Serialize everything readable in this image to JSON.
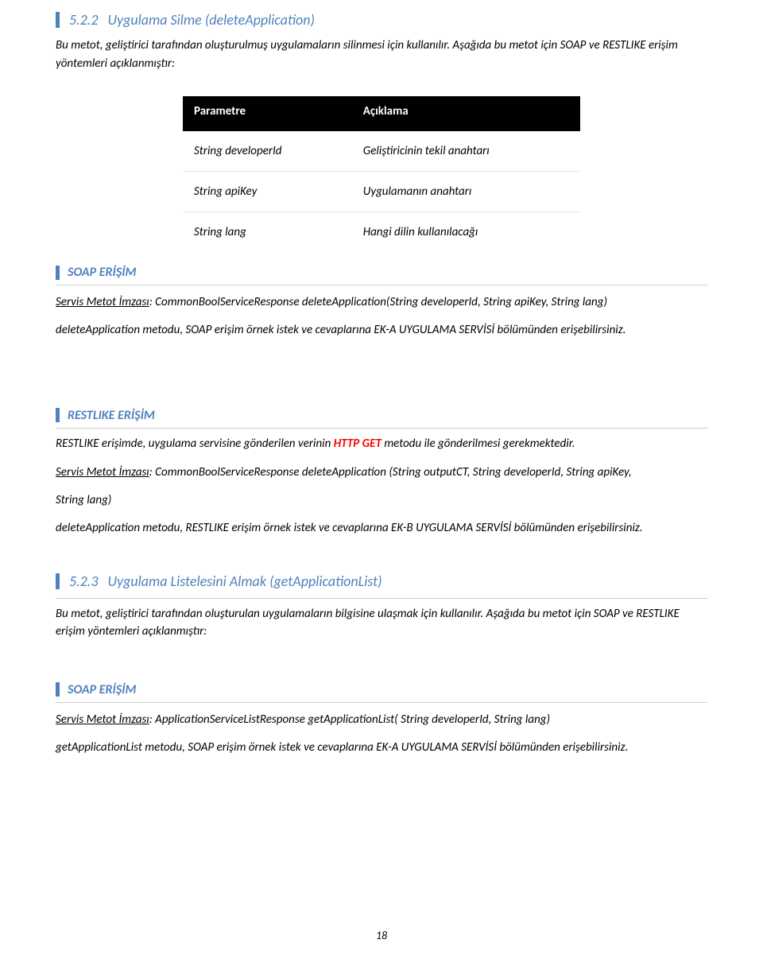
{
  "section1": {
    "num": "5.2.2",
    "title": "Uygulama Silme (deleteApplication)",
    "intro": "Bu metot, geliştirici tarafından oluşturulmuş uygulamaların silinmesi için kullanılır. Aşağıda bu metot için SOAP ve RESTLIKE erişim yöntemleri açıklanmıştır:"
  },
  "paramsTable": {
    "headers": {
      "param": "Parametre",
      "desc": "Açıklama"
    },
    "rows": [
      {
        "param": "String developerId",
        "desc": "Geliştiricinin tekil anahtarı"
      },
      {
        "param": "String apiKey",
        "desc": "Uygulamanın anahtarı"
      },
      {
        "param": "String lang",
        "desc": "Hangi dilin kullanılacağı"
      }
    ]
  },
  "soap1": {
    "label": "SOAP ERİŞİM",
    "sigPrefix": "Servis Metot İmzası",
    "sigBody": ": CommonBoolServiceResponse deleteApplication(String developerId, String apiKey, String lang)",
    "note": "deleteApplication metodu, SOAP erişim örnek istek ve cevaplarına EK-A UYGULAMA SERVİSİ bölümünden erişebilirsiniz."
  },
  "rest1": {
    "label": "RESTLIKE ERİŞİM",
    "introPre": "RESTLIKE erişimde, uygulama servisine gönderilen verinin ",
    "httpGet": "HTTP GET",
    "introPost": " metodu ile gönderilmesi gerekmektedir.",
    "sigPrefix": "Servis Metot İmzası",
    "sigBody1": ": CommonBoolServiceResponse deleteApplication (String outputCT, String developerId, String apiKey,",
    "sigBody2": "String lang)",
    "note": "deleteApplication metodu, RESTLIKE erişim örnek istek ve cevaplarına EK-B UYGULAMA SERVİSİ bölümünden erişebilirsiniz."
  },
  "section2": {
    "num": "5.2.3",
    "title": "Uygulama Listelesini Almak (getApplicationList)",
    "intro": "Bu metot, geliştirici tarafından oluşturulan uygulamaların bilgisine ulaşmak için kullanılır. Aşağıda bu metot için SOAP ve RESTLIKE erişim yöntemleri açıklanmıştır:"
  },
  "soap2": {
    "label": "SOAP ERİŞİM",
    "sigPrefix": "Servis Metot İmzası",
    "sigBody": ": ApplicationServiceListResponse getApplicationList( String developerId, String lang)",
    "note": "getApplicationList metodu, SOAP erişim örnek istek ve cevaplarına EK-A UYGULAMA SERVİSİ bölümünden erişebilirsiniz."
  },
  "pageNumber": "18"
}
